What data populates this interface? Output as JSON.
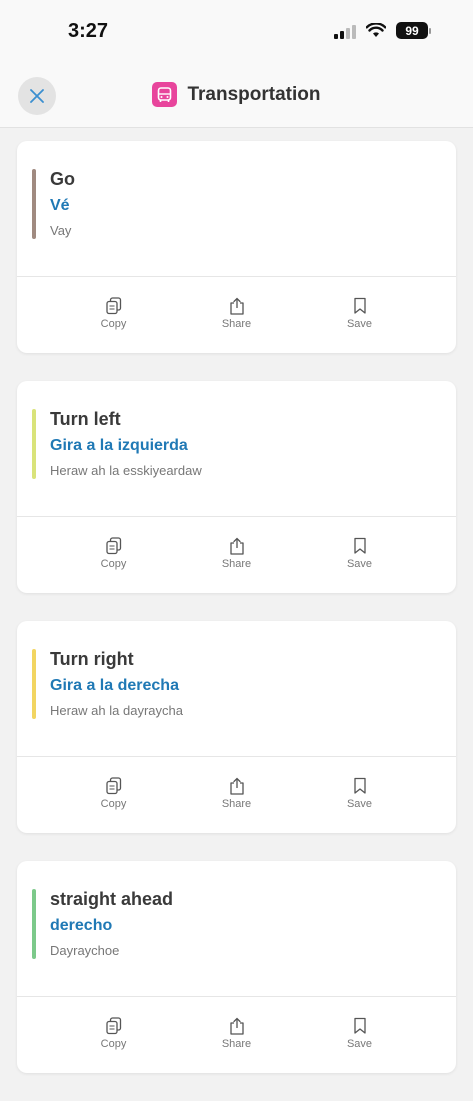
{
  "status": {
    "time": "3:27",
    "battery": "99"
  },
  "header": {
    "title": "Transportation"
  },
  "actions": {
    "copy": "Copy",
    "share": "Share",
    "save": "Save"
  },
  "cards": [
    {
      "english": "Go",
      "spanish": "Vé",
      "pronunciation": "Vay",
      "accent": "#a08a80"
    },
    {
      "english": "Turn left",
      "spanish": "Gira a la izquierda",
      "pronunciation": "Heraw ah la esskiyeardaw",
      "accent": "#d9e37a"
    },
    {
      "english": "Turn right",
      "spanish": "Gira a la derecha",
      "pronunciation": "Heraw ah la dayraycha",
      "accent": "#f2d561"
    },
    {
      "english": "straight ahead",
      "spanish": "derecho",
      "pronunciation": "Dayraychoe",
      "accent": "#7cc98a"
    }
  ]
}
